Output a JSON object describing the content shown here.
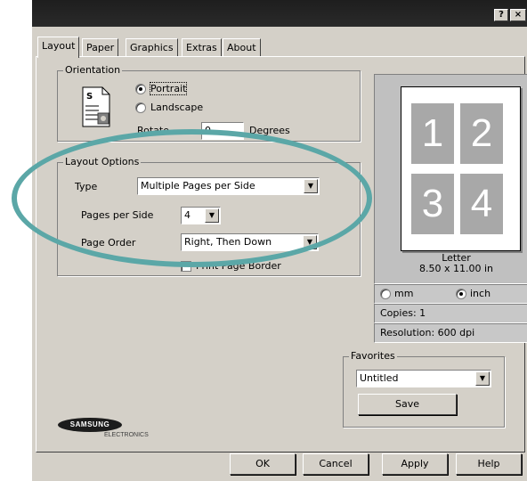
{
  "titlebar": {
    "help": "?",
    "close": "×"
  },
  "tabs": [
    "Layout",
    "Paper",
    "Graphics",
    "Extras",
    "About"
  ],
  "orientation": {
    "label": "Orientation",
    "portrait": "Portrait",
    "landscape": "Landscape",
    "rotate_label": "Rotate",
    "rotate_value": "0",
    "degrees": "Degrees"
  },
  "layout_options": {
    "label": "Layout Options",
    "type_label": "Type",
    "type_value": "Multiple Pages per Side",
    "pages_label": "Pages per Side",
    "pages_value": "4",
    "order_label": "Page Order",
    "order_value": "Right, Then Down",
    "border_label": "Print Page Border"
  },
  "preview": {
    "pages": [
      "1",
      "2",
      "3",
      "4"
    ],
    "paper": "Letter",
    "size": "8.50 x 11.00 in"
  },
  "units": {
    "mm": "mm",
    "inch": "inch",
    "selected": "inch"
  },
  "copies": "Copies: 1",
  "resolution": "Resolution: 600 dpi",
  "favorites": {
    "label": "Favorites",
    "value": "Untitled",
    "save": "Save"
  },
  "logo": {
    "brand": "SAMSUNG",
    "sub": "ELECTRONICS"
  },
  "buttons": {
    "ok": "OK",
    "cancel": "Cancel",
    "apply": "Apply",
    "help": "Help"
  },
  "colors": {
    "annotation": "#5ba7a7",
    "dialog": "#d4d0c8"
  }
}
